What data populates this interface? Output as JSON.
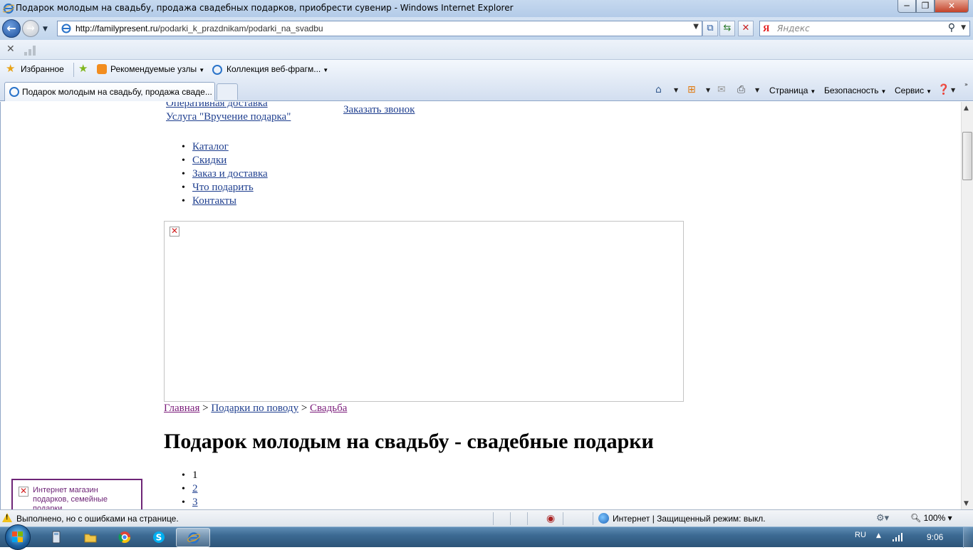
{
  "window": {
    "title": "Подарок молодым на свадьбу, продажа свадебных подарков, приобрести сувенир - Windows Internet Explorer",
    "minimize_glyph": "─",
    "maximize_glyph": "❐",
    "close_glyph": "✕"
  },
  "navigation": {
    "url_domain": "http://familypresent.ru",
    "url_path": "/podarki_k_prazdnikam/podarki_na_svadbu",
    "search_provider_glyph": "Я",
    "search_placeholder": "Яндекс",
    "back_glyph": "←",
    "forward_glyph": "→"
  },
  "favorites_bar": {
    "favorites_label": "Избранное",
    "recommended_label": "Рекомендуемые узлы",
    "webslices_label": "Коллекция веб-фрагм..."
  },
  "tabs": [
    {
      "label": "Подарок молодым на свадьбу, продажа сваде..."
    }
  ],
  "command_bar": {
    "page_label": "Страница",
    "safety_label": "Безопасность",
    "tools_label": "Сервис"
  },
  "page": {
    "top_links": {
      "quick_delivery": "Оперативная доставка",
      "gift_service": "Услуга \"Вручение подарка\"",
      "order_call": "Заказать звонок"
    },
    "menu": [
      "Каталог",
      "Скидки",
      "Заказ и доставка",
      "Что подарить",
      "Контакты"
    ],
    "breadcrumb": {
      "home": "Главная",
      "separator": ">",
      "occasion": "Подарки по поводу",
      "current": "Свадьба"
    },
    "heading": "Подарок молодым на свадьбу - свадебные подарки",
    "pager": [
      "1",
      "2",
      "3"
    ],
    "side_banner_alt": "Интернет магазин подарков, семейные подарки"
  },
  "status_bar": {
    "message": "Выполнено, но с ошибками на странице.",
    "zone": "Интернет | Защищенный режим: выкл.",
    "zoom": "100%"
  },
  "taskbar": {
    "language": "RU",
    "clock": "9:06"
  },
  "colors": {
    "link": "#1f3f8f",
    "visited_link": "#7a1b7a",
    "chrome_blue": "#c6d9ef",
    "taskbar": "#3c6a93"
  }
}
